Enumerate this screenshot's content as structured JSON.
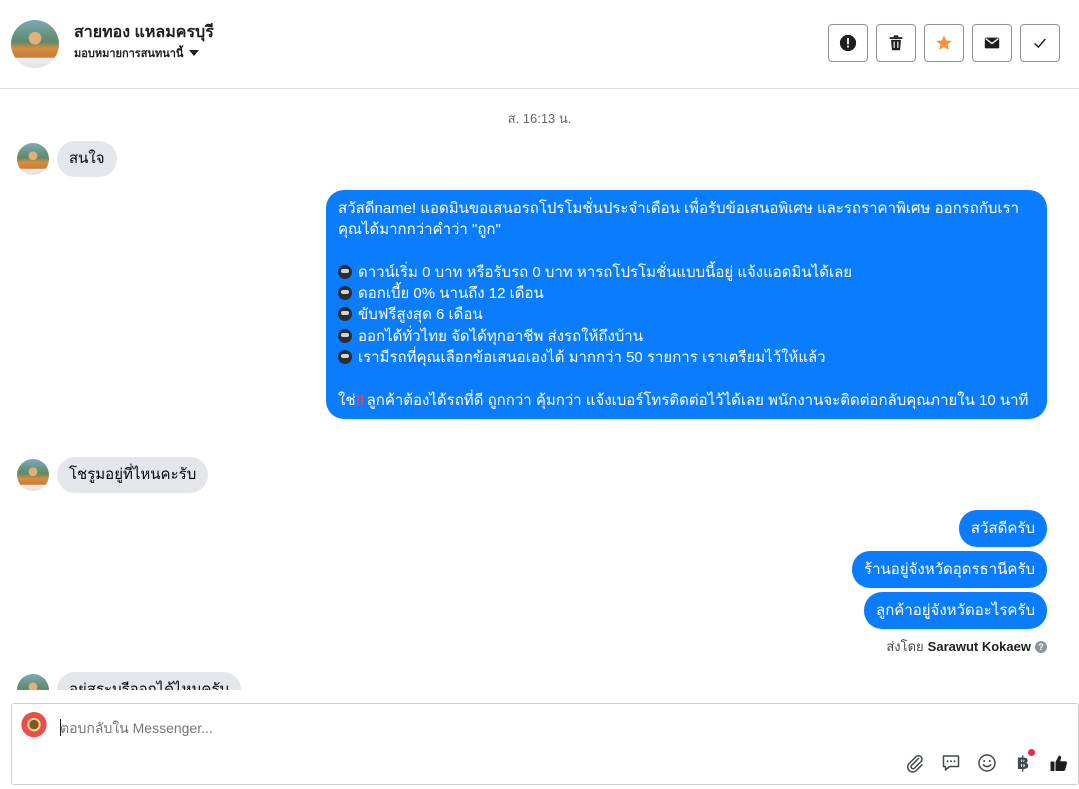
{
  "header": {
    "contact_name": "สายทอง แหลมครบุรี",
    "assign_label": "มอบหมายการสนทนานี้",
    "actions": [
      {
        "name": "report",
        "icon": "exclamation-icon"
      },
      {
        "name": "delete",
        "icon": "trash-icon"
      },
      {
        "name": "star",
        "icon": "star-icon",
        "color": "#f7923a"
      },
      {
        "name": "mark-unread",
        "icon": "envelope-icon"
      },
      {
        "name": "done",
        "icon": "check-icon"
      }
    ]
  },
  "thread": {
    "timestamp": "ส. 16:13 น.",
    "messages": {
      "in1": "สนใจ",
      "out_promo": {
        "line1": "สวัสดีname! แอดมินขอเสนอรถโปรโมชั่นประจำเดือน เพื่อรับข้อเสนอพิเศษ และรถราคาพิเศษ ออกรถกับเรา",
        "line2": "คุณได้มากกว่าคำว่า \"ถูก\"",
        "bullets": [
          "ดาวน์เริ่ม 0 บาท หรือรับรถ 0 บาท หารถโปรโมชั่นแบบนี้อยู่ แจ้งแอดมินได้เลย",
          "ดอกเบี้ย 0% นานถึง 12 เดือน",
          "ขับฟรีสูงสุด 6 เดือน",
          "ออกได้ทั่วไทย จัดได้ทุกอาชีพ ส่งรถให้ถึงบ้าน",
          "เรามีรถที่คุณเลือกข้อเสนอเองได้ มากกว่า 50 รายการ เราเตรียมไว้ให้แล้ว"
        ],
        "closing_prefix": "ใช่",
        "closing_mark": "‼",
        "closing": "ลูกค้าต้องได้รถที่ดี ถูกกว่า คุ้มกว่า แจ้งเบอร์โทรติดต่อไว้ได้เลย พนักงานจะติดต่อกลับคุณภายใน 10 นาที"
      },
      "in2": "โชรูมอยู่ที่ไหนคะรับ",
      "out1": "สวัสดีครับ",
      "out2": "ร้านอยู่จังหวัดอุดรธานีครับ",
      "out3": "ลูกค้าอยู่จังหวัดอะไรครับ",
      "in3": "อยู่สระบุรีออกได้ไหมครับ"
    },
    "sent_by_prefix": "ส่งโดย",
    "sent_by_name": "Sarawut Kokaew"
  },
  "composer": {
    "placeholder": "ตอบกลับใน Messenger...",
    "tools": [
      "paperclip-icon",
      "saved-reply-icon",
      "emoji-icon",
      "baht-icon",
      "thumbs-up-icon"
    ],
    "baht_symbol": "฿"
  },
  "colors": {
    "outgoing_bubble": "#0a7cff",
    "incoming_bubble": "#e4e6eb",
    "star": "#f7923a",
    "notification_dot": "#f02849"
  }
}
